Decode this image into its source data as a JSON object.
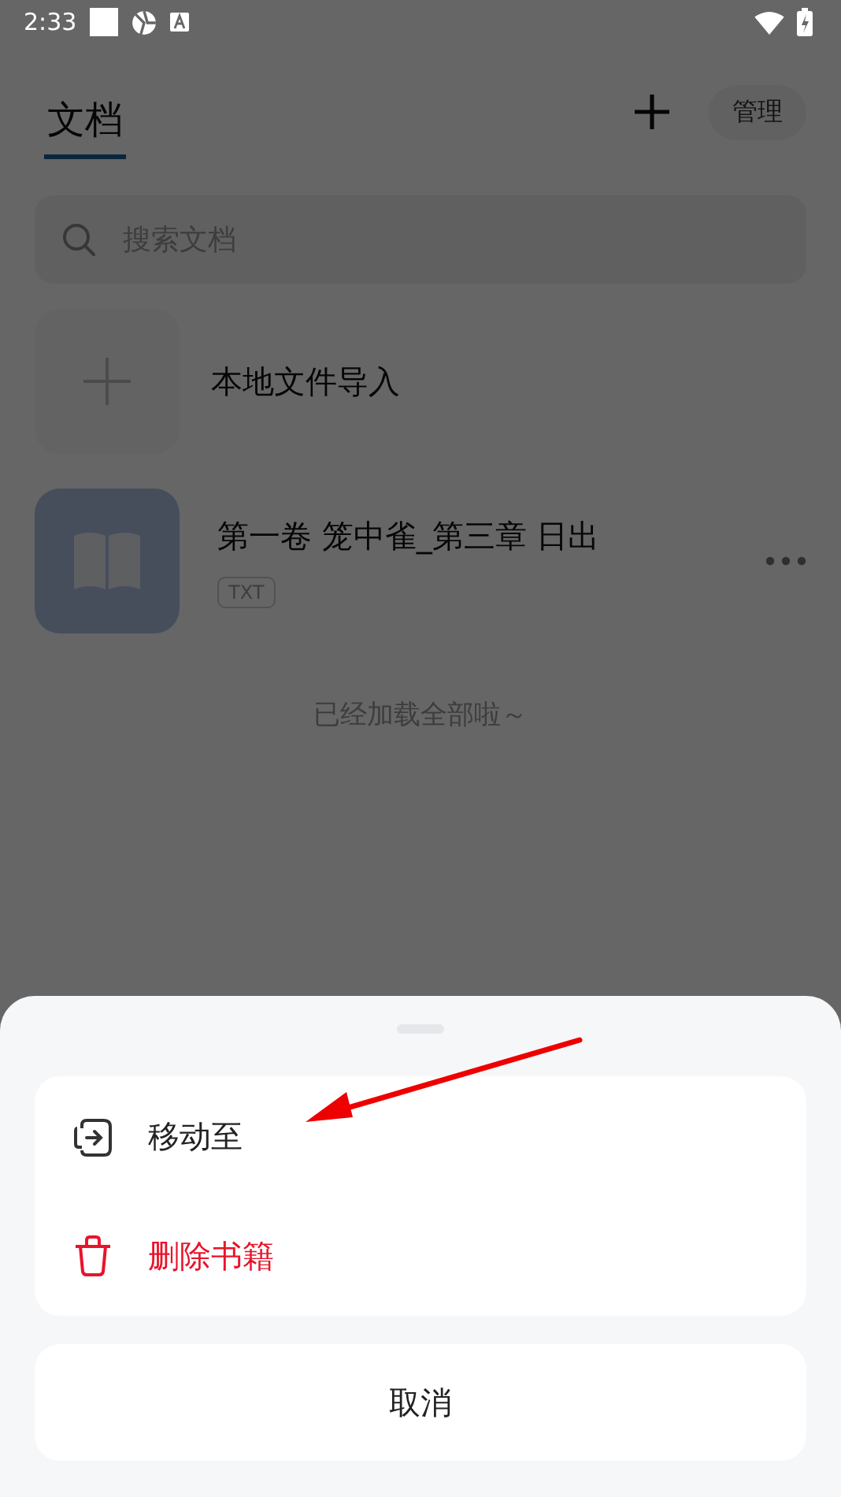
{
  "status_bar": {
    "time": "2:33"
  },
  "header": {
    "tabs": [
      {
        "label": "文档",
        "selected": true
      }
    ],
    "manage_button": "管理"
  },
  "search": {
    "placeholder": "搜索文档"
  },
  "import_item": {
    "label": "本地文件导入"
  },
  "documents": [
    {
      "title": "第一卷 笼中雀_第三章 日出",
      "format": "TXT"
    }
  ],
  "list_footer": "已经加载全部啦～",
  "action_sheet": {
    "items": [
      {
        "kind": "move",
        "label": "移动至"
      },
      {
        "kind": "delete",
        "label": "删除书籍"
      }
    ],
    "cancel": "取消"
  }
}
